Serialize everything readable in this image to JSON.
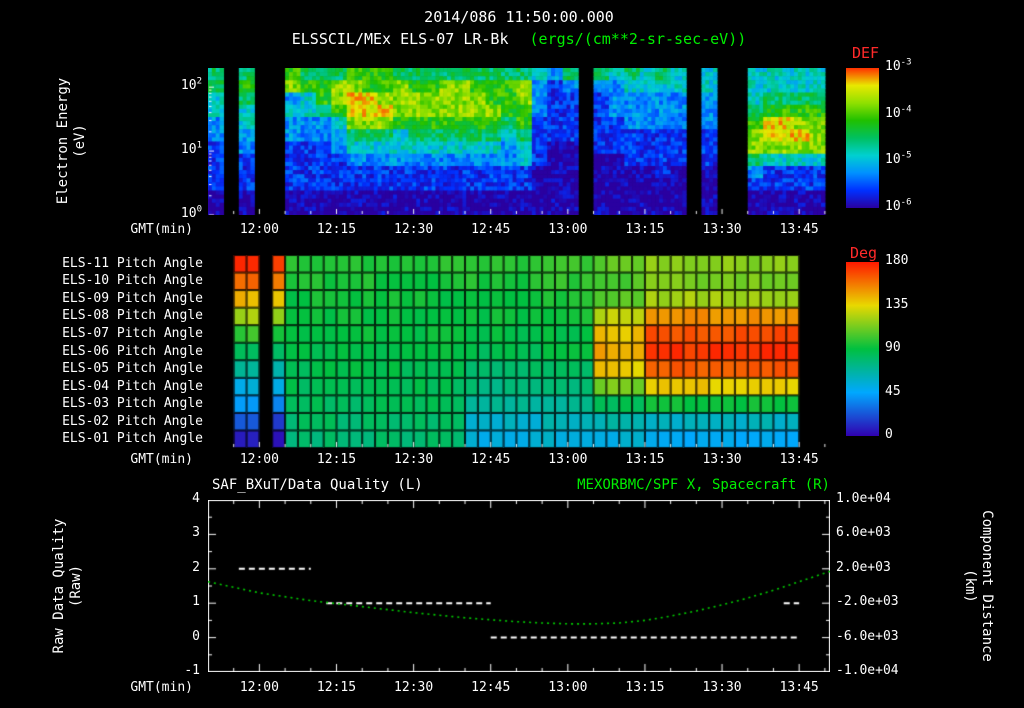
{
  "header": {
    "datetime": "2014/086 11:50:00.000",
    "instrument_title": "ELSSCIL/MEx ELS-07 LR-Bk",
    "units_title": "(ergs/(cm**2-sr-sec-eV))"
  },
  "colors": {
    "foreground": "#ffffff",
    "accent_green": "#00ee00",
    "accent_red": "#ff2a2a",
    "background": "#000000",
    "curve_green": "#00cc00"
  },
  "time_axis": {
    "label": "GMT(min)",
    "start": "11:50",
    "span_minutes": 121,
    "ticks": [
      "12:00",
      "12:15",
      "12:30",
      "12:45",
      "13:00",
      "13:15",
      "13:30",
      "13:45"
    ]
  },
  "chart_data": [
    {
      "type": "heatmap",
      "name": "electron-energy-spectrogram",
      "title": "ELSSCIL/MEx ELS-07 LR-Bk",
      "units": "(ergs/(cm**2-sr-sec-eV))",
      "ylabel": [
        "Electron Energy",
        "(eV)"
      ],
      "yscale": "log",
      "ylim_log": [
        0,
        2.3
      ],
      "yticks": [
        {
          "base": "10",
          "exp": "2"
        },
        {
          "base": "10",
          "exp": "1"
        },
        {
          "base": "10",
          "exp": "0"
        }
      ],
      "colorbar": {
        "title": "DEF",
        "ticks": [
          {
            "base": "10",
            "exp": "-3"
          },
          {
            "base": "10",
            "exp": "-4"
          },
          {
            "base": "10",
            "exp": "-5"
          },
          {
            "base": "10",
            "exp": "-6"
          }
        ],
        "stops": [
          "#2a00a0",
          "#0030ff",
          "#0090ff",
          "#00d0d0",
          "#00c060",
          "#20c000",
          "#90e000",
          "#e8e800",
          "#ff3000"
        ]
      },
      "col_minutes": 3,
      "level_legend": "0=no data, 1=lowest flux (1e-6), 9=highest flux (1e-3), rows top(100eV)->bottom(1eV)",
      "columns": [
        "554433222211",
        "000000000000",
        "565443322211",
        "000000000000",
        "000000000000",
        "673433222211",
        "564433222211",
        "566533222211",
        "577643322211",
        "678875432211",
        "668875432211",
        "667875432211",
        "577764432211",
        "567765432211",
        "567765432211",
        "577765432211",
        "577765432211",
        "567765432211",
        "566765432211",
        "566654332211",
        "577665442211",
        "433322221111",
        "322222111111",
        "532222111111",
        "000000000000",
        "532222211111",
        "433322211111",
        "543332221111",
        "443332221111",
        "543332222111",
        "443332221111",
        "000000000000",
        "443332221111",
        "000000000000",
        "000000000000",
        "444567753211",
        "445688742211",
        "445688742211",
        "445678742211",
        "445677742211"
      ]
    },
    {
      "type": "heatmap",
      "name": "pitch-angle-panels",
      "row_labels": [
        "ELS-11 Pitch Angle",
        "ELS-10 Pitch Angle",
        "ELS-09 Pitch Angle",
        "ELS-08 Pitch Angle",
        "ELS-07 Pitch Angle",
        "ELS-06 Pitch Angle",
        "ELS-05 Pitch Angle",
        "ELS-04 Pitch Angle",
        "ELS-03 Pitch Angle",
        "ELS-02 Pitch Angle",
        "ELS-01 Pitch Angle"
      ],
      "colorbar": {
        "title": "Deg",
        "ticks": [
          "180",
          "135",
          "90",
          "45",
          "0"
        ],
        "range": [
          0,
          180
        ],
        "stops": [
          "#3000b0",
          "#00a8ff",
          "#00c040",
          "#e8d800",
          "#ff1800"
        ]
      },
      "grid_minutes": 2.5,
      "data_end_min": 116,
      "segments": [
        {
          "t0": 0,
          "t1": 5,
          "rows": null
        },
        {
          "t0": 5,
          "t1": 10,
          "rows": [
            176,
            162,
            143,
            122,
            101,
            85,
            69,
            54,
            38,
            22,
            10
          ]
        },
        {
          "t0": 10,
          "t1": 12.5,
          "rows": null
        },
        {
          "t0": 12.5,
          "t1": 15,
          "rows": [
            172,
            156,
            136,
            116,
            96,
            80,
            64,
            48,
            33,
            18,
            8
          ]
        },
        {
          "t0": 15,
          "t1": 50,
          "rows": [
            96,
            94,
            92,
            91,
            90,
            89,
            87,
            85,
            83,
            81,
            79
          ]
        },
        {
          "t0": 50,
          "t1": 65,
          "rows": [
            97,
            95,
            93,
            91,
            89,
            86,
            82,
            76,
            68,
            58,
            52
          ]
        },
        {
          "t0": 65,
          "t1": 75,
          "rows": [
            101,
            99,
            96,
            93,
            90,
            88,
            84,
            79,
            70,
            62,
            55
          ]
        },
        {
          "t0": 75,
          "t1": 85,
          "rows": [
            107,
            104,
            109,
            126,
            140,
            146,
            138,
            114,
            86,
            64,
            54
          ]
        },
        {
          "t0": 85,
          "t1": 116,
          "rows": [
            116,
            113,
            121,
            152,
            168,
            173,
            164,
            138,
            92,
            60,
            48
          ]
        }
      ]
    },
    {
      "type": "line",
      "name": "quality-and-spacecraft-distance",
      "title_left": "SAF_BXuT/Data Quality (L)",
      "title_right": "MEXORBMC/SPF X, Spacecraft (R)",
      "ylabel": [
        "Raw Data Quality",
        "(Raw)"
      ],
      "yticks": [
        "4",
        "3",
        "2",
        "1",
        "0",
        "-1"
      ],
      "ylim": [
        -1,
        4
      ],
      "right_label": [
        "Component Distance",
        "(km)"
      ],
      "right_ticks": [
        "1.0e+04",
        "6.0e+03",
        "2.0e+03",
        "-2.0e+03",
        "-6.0e+03",
        "-1.0e+04"
      ],
      "right_lim": [
        -10000,
        10000
      ],
      "series": [
        {
          "name": "SAF_BXuT/Data Quality",
          "axis": "left",
          "style": "dashed",
          "color": "#ffffff",
          "segments": [
            {
              "t0": 6,
              "t1": 20,
              "y": 2
            },
            {
              "t0": 23,
              "t1": 55,
              "y": 1
            },
            {
              "t0": 55,
              "t1": 115,
              "y": 0
            },
            {
              "t0": 112,
              "t1": 115,
              "y": 1
            }
          ]
        },
        {
          "name": "MEXORBMC/SPF X Spacecraft",
          "axis": "right",
          "style": "dotted",
          "color": "#00cc00",
          "t": [
            0,
            10,
            20,
            30,
            40,
            50,
            60,
            65,
            70,
            75,
            80,
            85,
            90,
            95,
            100,
            105,
            110,
            115,
            121
          ],
          "km": [
            500,
            -800,
            -1700,
            -2400,
            -3100,
            -3700,
            -4150,
            -4300,
            -4400,
            -4400,
            -4300,
            -4000,
            -3500,
            -2900,
            -2200,
            -1400,
            -500,
            500,
            1700
          ]
        }
      ]
    }
  ]
}
